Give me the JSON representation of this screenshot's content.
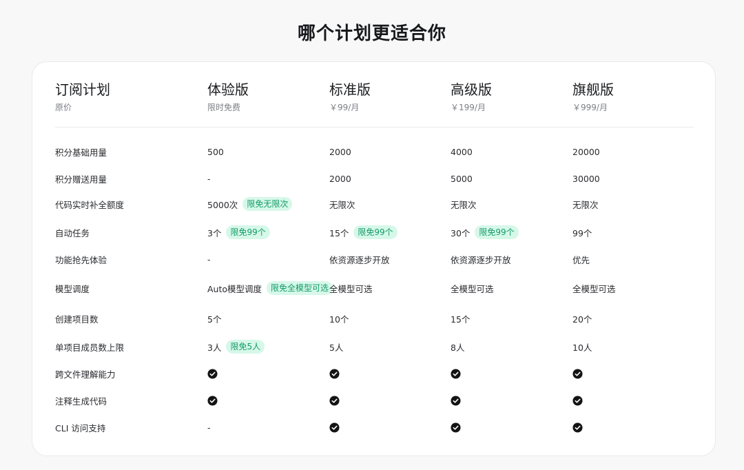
{
  "page_title": "哪个计划更适合你",
  "header": {
    "label_title": "订阅计划",
    "label_sub": "原价",
    "plans": [
      {
        "name": "体验版",
        "price": "限时免费"
      },
      {
        "name": "标准版",
        "price": "￥99/月"
      },
      {
        "name": "高级版",
        "price": "￥199/月"
      },
      {
        "name": "旗舰版",
        "price": "￥999/月"
      }
    ]
  },
  "rows": [
    {
      "label": "积分基础用量",
      "cells": [
        {
          "text": "500"
        },
        {
          "text": "2000"
        },
        {
          "text": "4000"
        },
        {
          "text": "20000"
        }
      ]
    },
    {
      "label": "积分赠送用量",
      "cells": [
        {
          "text": "-"
        },
        {
          "text": "2000"
        },
        {
          "text": "5000"
        },
        {
          "text": "30000"
        }
      ]
    },
    {
      "label": "代码实时补全额度",
      "cells": [
        {
          "text": "5000次",
          "badge": "限免无限次"
        },
        {
          "text": "无限次"
        },
        {
          "text": "无限次"
        },
        {
          "text": "无限次"
        }
      ]
    },
    {
      "label": "自动任务",
      "cells": [
        {
          "text": "3个",
          "badge": "限免99个"
        },
        {
          "text": "15个",
          "badge": "限免99个"
        },
        {
          "text": "30个",
          "badge": "限免99个"
        },
        {
          "text": "99个"
        }
      ]
    },
    {
      "label": "功能抢先体验",
      "cells": [
        {
          "text": "-"
        },
        {
          "text": "依资源逐步开放"
        },
        {
          "text": "依资源逐步开放"
        },
        {
          "text": "优先"
        }
      ]
    },
    {
      "label": "模型调度",
      "cells": [
        {
          "text": "Auto模型调度",
          "badge": "限免全模型可选"
        },
        {
          "text": "全模型可选"
        },
        {
          "text": "全模型可选"
        },
        {
          "text": "全模型可选"
        }
      ]
    },
    {
      "label": "创建项目数",
      "cells": [
        {
          "text": "5个"
        },
        {
          "text": "10个"
        },
        {
          "text": "15个"
        },
        {
          "text": "20个"
        }
      ]
    },
    {
      "label": "单项目成员数上限",
      "cells": [
        {
          "text": "3人",
          "badge": "限免5人"
        },
        {
          "text": "5人"
        },
        {
          "text": "8人"
        },
        {
          "text": "10人"
        }
      ]
    },
    {
      "label": "跨文件理解能力",
      "cells": [
        {
          "icon": "check-circle-icon"
        },
        {
          "icon": "check-circle-icon"
        },
        {
          "icon": "check-circle-icon"
        },
        {
          "icon": "check-circle-icon"
        }
      ]
    },
    {
      "label": "注释生成代码",
      "cells": [
        {
          "icon": "check-circle-icon"
        },
        {
          "icon": "check-circle-icon"
        },
        {
          "icon": "check-circle-icon"
        },
        {
          "icon": "check-circle-icon"
        }
      ]
    },
    {
      "label": "CLI 访问支持",
      "cells": [
        {
          "text": "-"
        },
        {
          "icon": "check-circle-icon"
        },
        {
          "icon": "check-circle-icon"
        },
        {
          "icon": "check-circle-icon"
        }
      ]
    }
  ],
  "colors": {
    "badge_text": "#159a6a",
    "badge_bg": "#d6f8e9",
    "check_fill": "#141414"
  }
}
